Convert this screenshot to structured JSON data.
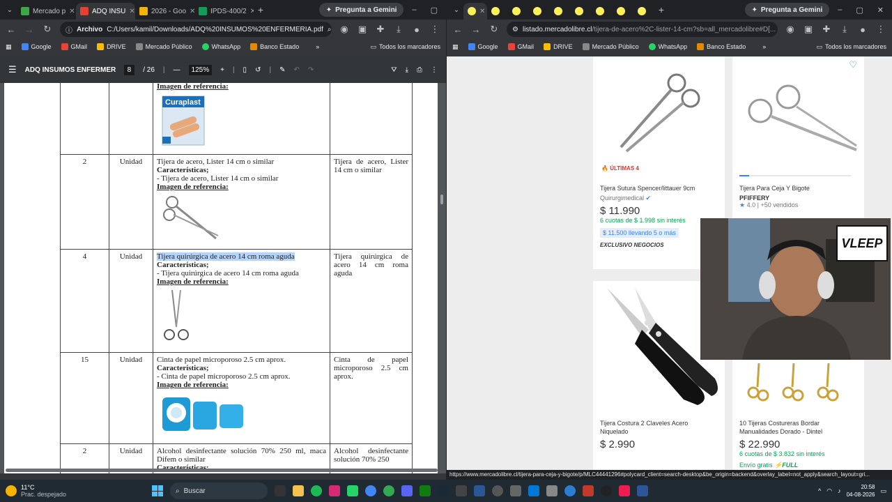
{
  "left_window": {
    "tabs": [
      {
        "label": "Mercado p",
        "color": "#3ea845"
      },
      {
        "label": "ADQ INSU",
        "color": "#e34133"
      },
      {
        "label": "2026 - Goo",
        "color": "#f4b400"
      },
      {
        "label": "IPDS-400/2",
        "color": "#0f9d58"
      }
    ],
    "gemini": "Pregunta a Gemini",
    "chip": "Archivo",
    "url": "C:/Users/kamil/Downloads/ADQ%20INSUMOS%20ENFERMERIA.pdf",
    "pdf": {
      "title": "ADQ INSUMOS ENFERMERI...",
      "page": "8",
      "total": "/ 26",
      "zoom": "125%",
      "rows": [
        {
          "qty": "",
          "unit": "",
          "name": "",
          "caract": "",
          "dash": "",
          "ref": "Imagen de referencia:",
          "col4": "",
          "img": "curaplast"
        },
        {
          "qty": "2",
          "unit": "Unidad",
          "name": "Tijera de acero, Lister 14 cm o similar",
          "caract": "Características;",
          "dash": "- Tijera de acero, Lister 14 cm o similar",
          "ref": "Imagen de referencia:",
          "col4": "Tijera de acero, Lister 14 cm o similar",
          "img": "lister"
        },
        {
          "qty": "4",
          "unit": "Unidad",
          "name": "Tijera quirúrgica de acero 14 cm roma aguda",
          "caract": "Características;",
          "dash": "- Tijera quirúrgica de acero 14 cm roma aguda",
          "ref": "Imagen de referencia:",
          "col4": "Tijera quirúrgica de acero 14 cm roma aguda",
          "img": "scissors"
        },
        {
          "qty": "15",
          "unit": "Unidad",
          "name": "Cinta de papel microporoso 2.5 cm aprox.",
          "caract": "Características;",
          "dash": "- Cinta de papel microporoso 2.5 cm aprox.",
          "ref": "Imagen de referencia:",
          "col4": "Cinta de papel microporoso 2.5 cm aprox.",
          "img": "tape"
        },
        {
          "qty": "2",
          "unit": "Unidad",
          "name": "Alcohol desinfectante solución 70% 250 ml, maca Difem o similar",
          "caract": "Características;",
          "dash": "",
          "ref": "",
          "col4": "Alcohol desinfectante solución 70% 250",
          "img": ""
        }
      ],
      "curaplast_label": "Curaplast"
    }
  },
  "right_window": {
    "gemini": "Pregunta a Gemini",
    "url_host": "listado.mercadolibre.cl",
    "url_path": "/tijera-de-acero%2C-lister-14-cm?sb=all_mercadolibre#D[...",
    "status_url": "https://www.mercadolibre.cl/tijera-para-ceja-y-bigote/p/MLC44441296#polycard_client=search-desktop&be_origin=backend&overlay_label=not_apply&search_layout=gri...",
    "cards": [
      {
        "badge_top": "ÚLTIMAS 4",
        "title": "Tijera Sutura Spencer/littauer 9cm",
        "seller": "Quirurgimedical",
        "price": "$ 11.990",
        "inst": "6 cuotas de $ 1.998 sin interés",
        "promo": "$ 11.500 llevando 5 o más",
        "excl": "EXCLUSIVO NEGOCIOS"
      },
      {
        "title": "Tijera Para Ceja Y Bigote",
        "brand": "PFIFFERY",
        "rating": "4.0 | +50 vendidos"
      },
      {
        "title": "Tijera Costura 2 Claveles Acero Niquelado",
        "price": "$ 2.990"
      },
      {
        "title": "10 Tijeras Costureras Bordar Manualidades Dorado - Dintel",
        "price": "$ 22.990",
        "inst": "6 cuotas de $ 3.832 sin interés",
        "ship": "Envío gratis",
        "full": "FULL"
      }
    ]
  },
  "bookmarks": [
    "Google",
    "GMail",
    "DRIVE",
    "Mercado Público",
    "WhatsApp",
    "Banco Estado"
  ],
  "all_bookmarks": "Todos los marcadores",
  "webcam_logo": "VLEEP",
  "taskbar": {
    "temp": "11°C",
    "weather": "Prac. despejado",
    "search": "Buscar",
    "time": "20:58",
    "date": "04-08-2026"
  }
}
